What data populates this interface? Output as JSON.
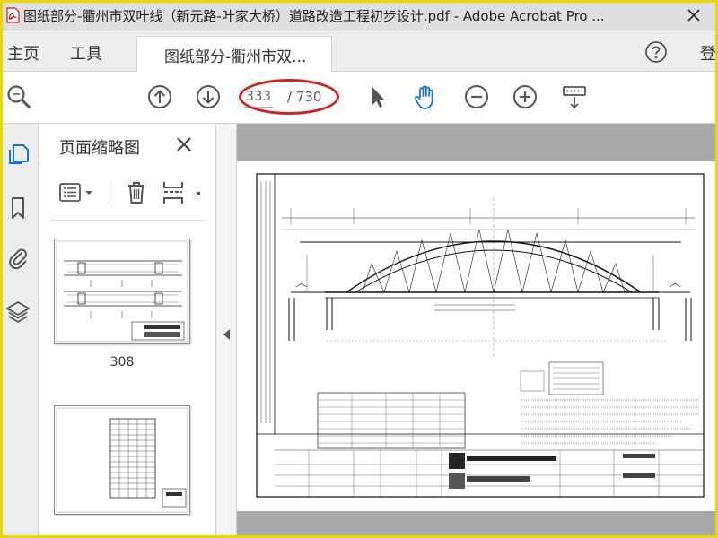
{
  "window": {
    "title": "图纸部分-衢州市双叶线（新元路-叶家大桥）道路改造工程初步设计.pdf - Adobe Acrobat Pro ...",
    "app_icon": "acrobat-icon",
    "close_icon": "close-icon"
  },
  "menubar": {
    "home_label": "主页",
    "tools_label": "工具",
    "doc_tab_label": "图纸部分-衢州市双...",
    "login_label": "登"
  },
  "toolbar": {
    "current_page": "333",
    "page_total": "/ 730",
    "icons": [
      "zoom-icon",
      "prev-page-icon",
      "next-page-icon",
      "select-pointer-icon",
      "hand-tool-icon",
      "zoom-out-icon",
      "zoom-in-icon",
      "keyboard-scroll-icon"
    ],
    "active_tool": "hand-tool",
    "accent_color": "#1473e6"
  },
  "sidebar_rail": {
    "icons": [
      "page-thumbnails-icon",
      "bookmark-icon",
      "attachment-icon",
      "layers-icon"
    ]
  },
  "thumbnails_panel": {
    "title": "页面缩略图",
    "close_icon": "close-icon",
    "tools": [
      "thumbnail-options-icon",
      "delete-page-icon",
      "insert-page-icon"
    ],
    "pages": [
      {
        "label": "308"
      },
      {
        "label": ""
      }
    ]
  },
  "annotation": {
    "highlight_color": "#d32020"
  }
}
